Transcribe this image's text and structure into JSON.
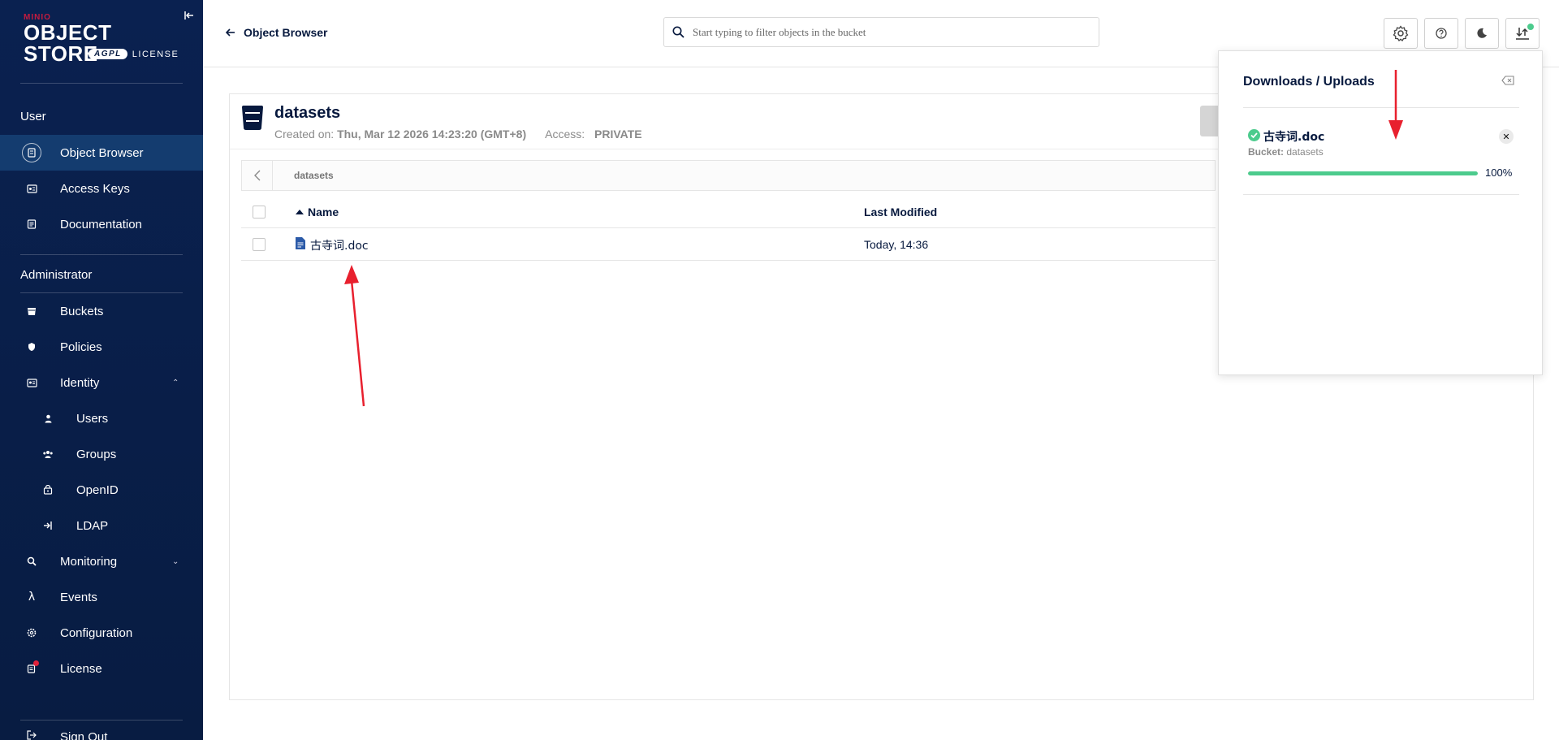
{
  "app": {
    "logo_brand": "MINIO",
    "logo_product": "OBJECT STORE",
    "logo_license_badge": "AGPL",
    "logo_license_text": "LICENSE"
  },
  "sidebar": {
    "user_section": "User",
    "admin_section": "Administrator",
    "items": [
      {
        "label": "Object Browser",
        "icon": "object-browser-icon",
        "active": true
      },
      {
        "label": "Access Keys",
        "icon": "access-keys-icon"
      },
      {
        "label": "Documentation",
        "icon": "documentation-icon"
      },
      {
        "label": "Buckets",
        "icon": "buckets-icon"
      },
      {
        "label": "Policies",
        "icon": "policies-icon"
      },
      {
        "label": "Identity",
        "icon": "identity-icon",
        "expanded": true
      },
      {
        "label": "Users",
        "icon": "users-icon"
      },
      {
        "label": "Groups",
        "icon": "groups-icon"
      },
      {
        "label": "OpenID",
        "icon": "openid-icon"
      },
      {
        "label": "LDAP",
        "icon": "ldap-icon"
      },
      {
        "label": "Monitoring",
        "icon": "monitoring-icon"
      },
      {
        "label": "Events",
        "icon": "lambda-icon"
      },
      {
        "label": "Configuration",
        "icon": "gear-icon"
      },
      {
        "label": "License",
        "icon": "license-icon"
      },
      {
        "label": "Sign Out",
        "icon": "sign-out-icon"
      }
    ]
  },
  "header": {
    "back_label": "Object Browser",
    "search_placeholder": "Start typing to filter objects in the bucket"
  },
  "bucket": {
    "name": "datasets",
    "created_label": "Created on:",
    "created_value": "Thu, Mar 12 2026 14:23:20 (GMT+8)",
    "access_label": "Access:",
    "access_value": "PRIVATE",
    "breadcrumb": "datasets"
  },
  "table": {
    "columns": [
      "Name",
      "Last Modified"
    ],
    "rows": [
      {
        "name": "古寺词.doc",
        "modified": "Today, 14:36"
      }
    ]
  },
  "downloads": {
    "title": "Downloads / Uploads",
    "item_name": "古寺词.doc",
    "bucket_label": "Bucket:",
    "bucket_value": "datasets",
    "progress": 1.0,
    "progress_text": "100%"
  },
  "colors": {
    "sidebar_bg": "#081C42",
    "active_item": "#143C6F",
    "accent_green": "#4ccb8d",
    "arrow_red": "#e8202e"
  }
}
